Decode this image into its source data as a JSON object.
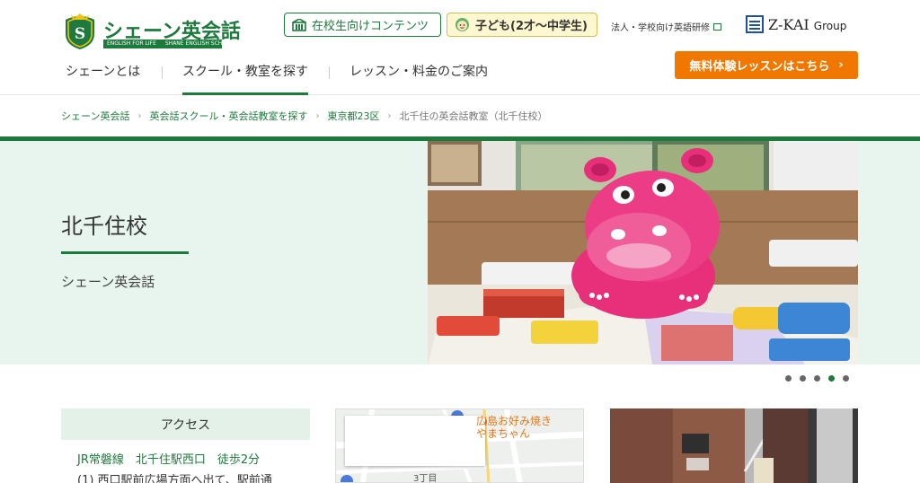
{
  "header": {
    "logo": {
      "text": "シェーン英会話",
      "tagline_left": "ENGLISH FOR LIFE",
      "tagline_right": "SHANE ENGLISH SCHOOL"
    },
    "utility": {
      "students_label": "在校生向けコンテンツ",
      "kids_label": "子ども(2才〜中学生)",
      "corporate_label": "法人・学校向け英語研修",
      "group_main": "Z-KAI",
      "group_sub": "Group"
    },
    "nav": [
      {
        "label": "シェーンとは"
      },
      {
        "label": "スクール・教室を探す",
        "active": true
      },
      {
        "label": "レッスン・料金のご案内"
      }
    ],
    "cta_label": "無料体験レッスンはこちら"
  },
  "breadcrumb": [
    "シェーン英会話",
    "英会話スクール・英会話教室を探す",
    "東京都23区",
    "北千住の英会話教室（北千住校）"
  ],
  "hero": {
    "title": "北千住校",
    "subtitle": "シェーン英会話",
    "slide_count": 5,
    "active_slide": 4
  },
  "access": {
    "heading": "アクセス",
    "line1": "JR常磐線　北千住駅西口　徒歩2分",
    "line2": "(1) 西口駅前広場方面へ出て、駅前通"
  },
  "map": {
    "poi_line1": "広島お好み焼き",
    "poi_line2": "やまちゃん",
    "area_label": "3丁目"
  },
  "colors": {
    "brand_green": "#1e7a3c",
    "cta_orange": "#f07800",
    "hero_bg": "#e8f4ee"
  }
}
